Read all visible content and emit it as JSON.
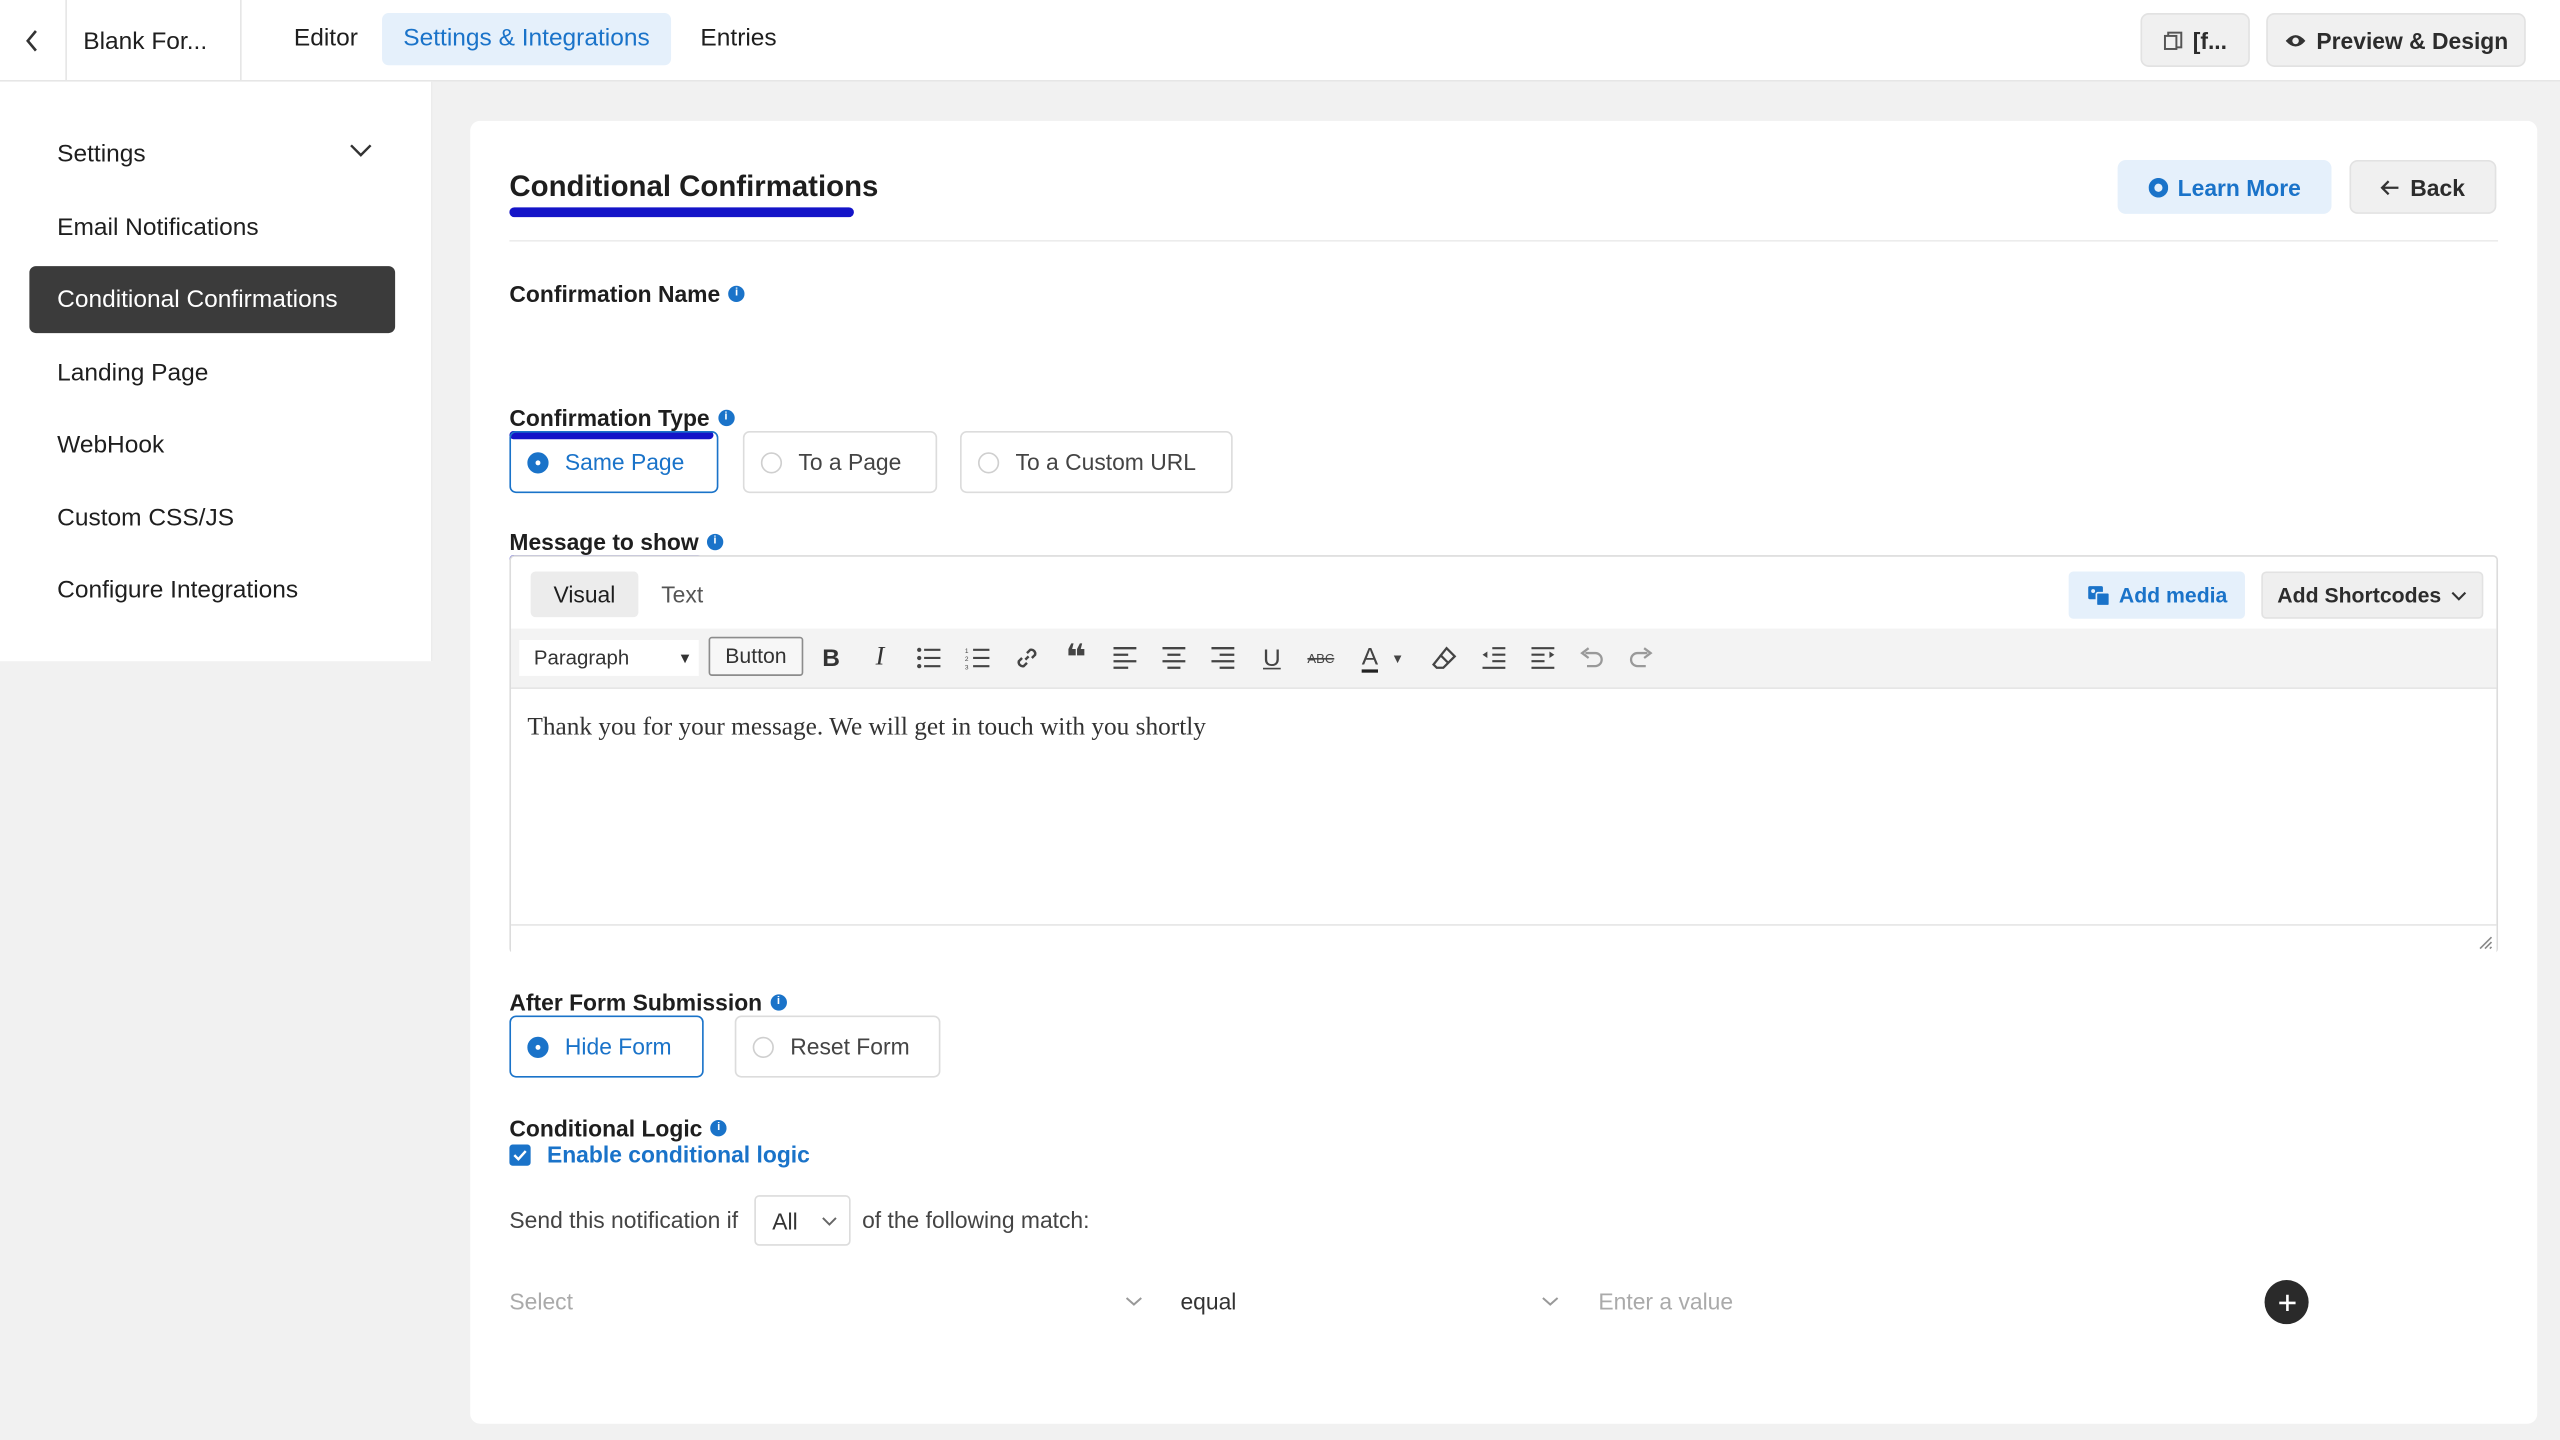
{
  "topbar": {
    "form_title": "Blank For...",
    "tabs": [
      {
        "label": "Editor"
      },
      {
        "label": "Settings & Integrations"
      },
      {
        "label": "Entries"
      }
    ],
    "shortcode_btn": "[f...",
    "preview_btn": "Preview & Design"
  },
  "sidebar": {
    "items": [
      {
        "label": "Settings"
      },
      {
        "label": "Email Notifications"
      },
      {
        "label": "Conditional Confirmations"
      },
      {
        "label": "Landing Page"
      },
      {
        "label": "WebHook"
      },
      {
        "label": "Custom CSS/JS"
      },
      {
        "label": "Configure Integrations"
      }
    ]
  },
  "main": {
    "heading": "Conditional Confirmations",
    "learn_more": "Learn More",
    "back": "Back",
    "confirmation_name_label": "Confirmation Name",
    "confirmation_type_label": "Confirmation Type",
    "confirmation_types": [
      "Same Page",
      "To a Page",
      "To a Custom URL"
    ],
    "message_label": "Message to show",
    "editor": {
      "tab_visual": "Visual",
      "tab_text": "Text",
      "add_media": "Add media",
      "add_shortcodes": "Add Shortcodes",
      "format_select": "Paragraph",
      "button_label": "Button",
      "content": "Thank you for your message. We will get in touch with you shortly"
    },
    "after_submission_label": "After Form Submission",
    "after_submission_options": [
      "Hide Form",
      "Reset Form"
    ],
    "conditional_logic_label": "Conditional Logic",
    "enable_logic": "Enable conditional logic",
    "send_prefix": "Send this notification if",
    "match_select": "All",
    "send_suffix": "of the following match:",
    "condition": {
      "field_placeholder": "Select",
      "operator": "equal",
      "value_placeholder": "Enter a value"
    }
  },
  "colors": {
    "accent": "#1a73c9",
    "active_sidebar": "#3b3b3b",
    "annotation_underline": "#1414c8"
  }
}
